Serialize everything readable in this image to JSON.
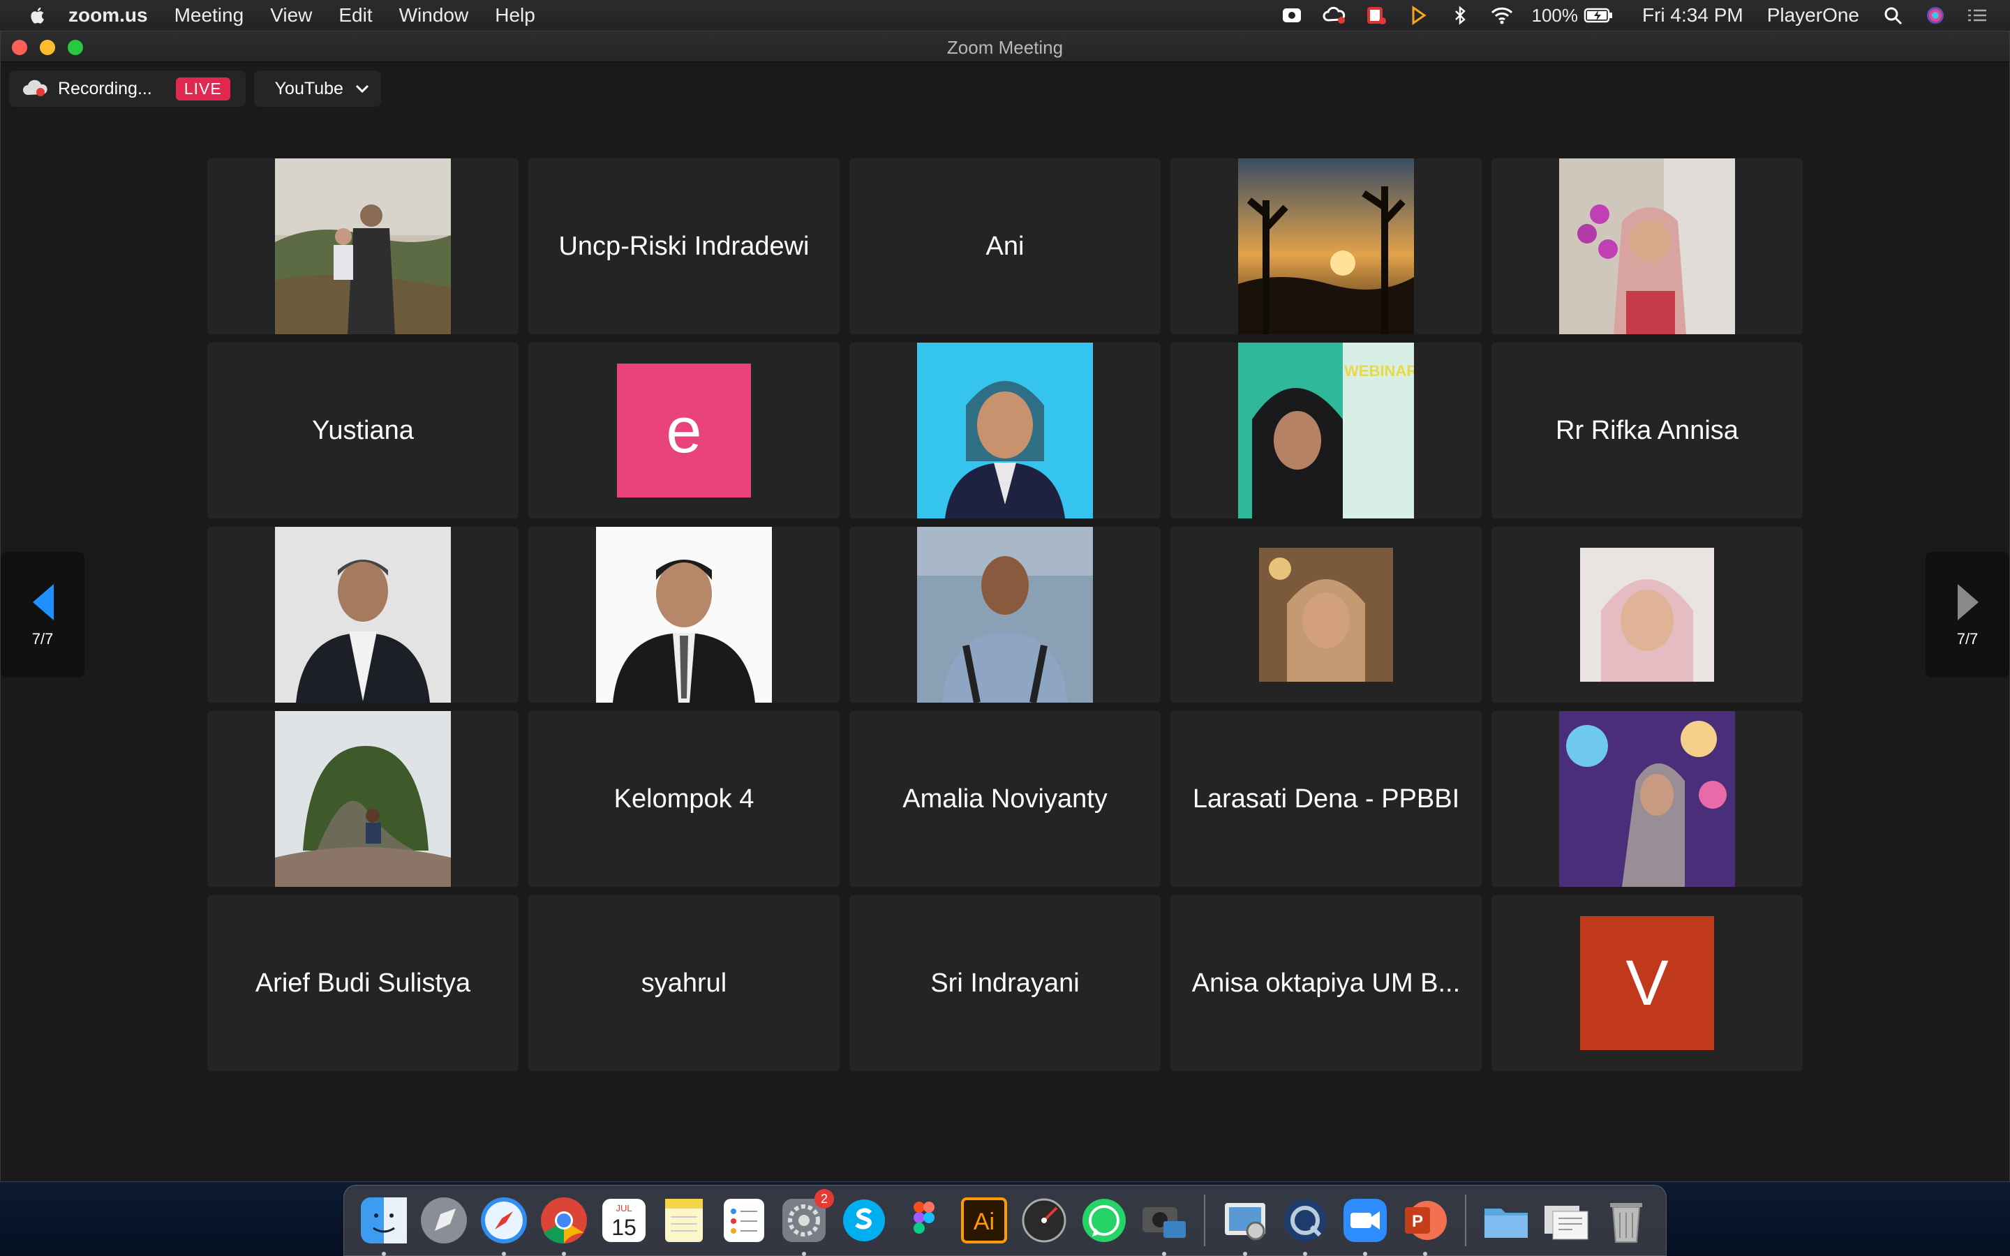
{
  "menubar": {
    "app_name": "zoom.us",
    "menus": [
      "Meeting",
      "View",
      "Edit",
      "Window",
      "Help"
    ],
    "battery": "100%",
    "clock": "Fri 4:34 PM",
    "user": "PlayerOne"
  },
  "window": {
    "title": "Zoom Meeting"
  },
  "recording": {
    "status": "Recording...",
    "live_badge": "LIVE",
    "stream_target": "YouTube"
  },
  "gallery": {
    "page_indicator": "7/7",
    "tiles": [
      {
        "type": "photo",
        "name": "",
        "image": "man-holding-child-outdoors"
      },
      {
        "type": "name",
        "name": "Uncp-Riski Indradewi"
      },
      {
        "type": "name",
        "name": "Ani"
      },
      {
        "type": "photo",
        "name": "",
        "image": "sunset-through-trees"
      },
      {
        "type": "photo",
        "name": "",
        "image": "woman-hijab-with-orchids"
      },
      {
        "type": "name",
        "name": "Yustiana"
      },
      {
        "type": "avatar",
        "letter": "e",
        "color": "#e8437a"
      },
      {
        "type": "photo",
        "name": "",
        "image": "woman-hijab-blue-background"
      },
      {
        "type": "photo",
        "name": "",
        "image": "woman-webinar-poster"
      },
      {
        "type": "name",
        "name": "Rr Rifka Annisa"
      },
      {
        "type": "photo",
        "name": "",
        "image": "man-suit-grey-background"
      },
      {
        "type": "photo",
        "name": "",
        "image": "man-suit-white-background"
      },
      {
        "type": "photo",
        "name": "",
        "image": "man-uniform-seaside"
      },
      {
        "type": "photo",
        "name": "",
        "image": "woman-hijab-selfie"
      },
      {
        "type": "photo",
        "name": "",
        "image": "girl-hijab-selfie"
      },
      {
        "type": "photo",
        "name": "",
        "image": "man-sitting-on-rock-hill"
      },
      {
        "type": "name",
        "name": "Kelompok 4"
      },
      {
        "type": "name",
        "name": "Amalia Noviyanty"
      },
      {
        "type": "name",
        "name": "Larasati Dena - PPBBI"
      },
      {
        "type": "photo",
        "name": "",
        "image": "woman-under-lights"
      },
      {
        "type": "name",
        "name": "Arief Budi Sulistya"
      },
      {
        "type": "name",
        "name": "syahrul"
      },
      {
        "type": "name",
        "name": "Sri Indrayani"
      },
      {
        "type": "name",
        "name": "Anisa oktapiya UM B..."
      },
      {
        "type": "avatar",
        "letter": "V",
        "color": "#c0391b"
      }
    ]
  },
  "webinar_poster_text": "WEBINAR",
  "dock": {
    "calendar_month": "JUL",
    "calendar_day": "15",
    "settings_badge": "2",
    "illustrator_label": "Ai",
    "powerpoint_label": "P"
  },
  "colors": {
    "live": "#e02850",
    "pager_arrow_left": "#1e90ff",
    "pager_arrow_right": "#8a8a8a",
    "tile_bg": "#242424"
  }
}
